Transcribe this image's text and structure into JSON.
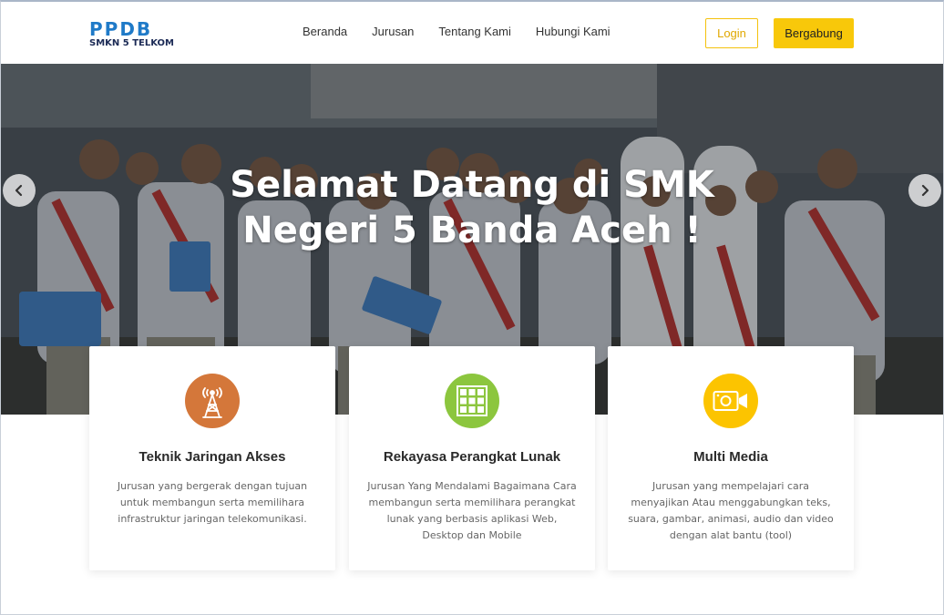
{
  "brand": {
    "logo_text": "PPDB",
    "logo_subtitle": "SMKN 5 TELKOM",
    "logo_color": "#1f7ac8"
  },
  "nav": {
    "items": [
      {
        "label": "Beranda"
      },
      {
        "label": "Jurusan"
      },
      {
        "label": "Tentang Kami"
      },
      {
        "label": "Hubungi Kami"
      }
    ],
    "login_label": "Login",
    "join_label": "Bergabung",
    "accent_color": "#f8c80a"
  },
  "hero": {
    "title_line1": "Selamat Datang di SMK",
    "title_line2": "Negeri 5 Banda Aceh !",
    "prev_icon": "chevron-left-icon",
    "next_icon": "chevron-right-icon"
  },
  "cards": [
    {
      "title": "Teknik Jaringan Akses",
      "description": "Jurusan yang bergerak dengan tujuan untuk membangun serta memilihara infrastruktur jaringan telekomunikasi.",
      "icon": "antenna-tower-icon",
      "icon_color": "#d4773a"
    },
    {
      "title": "Rekayasa Perangkat Lunak",
      "description": "Jurusan Yang Mendalami Bagaimana Cara membangun serta memilihara perangkat lunak yang berbasis aplikasi Web, Desktop dan Mobile",
      "icon": "grid-icon",
      "icon_color": "#8cc63e"
    },
    {
      "title": "Multi Media",
      "description": "Jurusan yang mempelajari cara menyajikan Atau menggabungkan teks, suara, gambar, animasi, audio dan video dengan alat bantu (tool)",
      "icon": "video-camera-icon",
      "icon_color": "#fcc400"
    }
  ]
}
